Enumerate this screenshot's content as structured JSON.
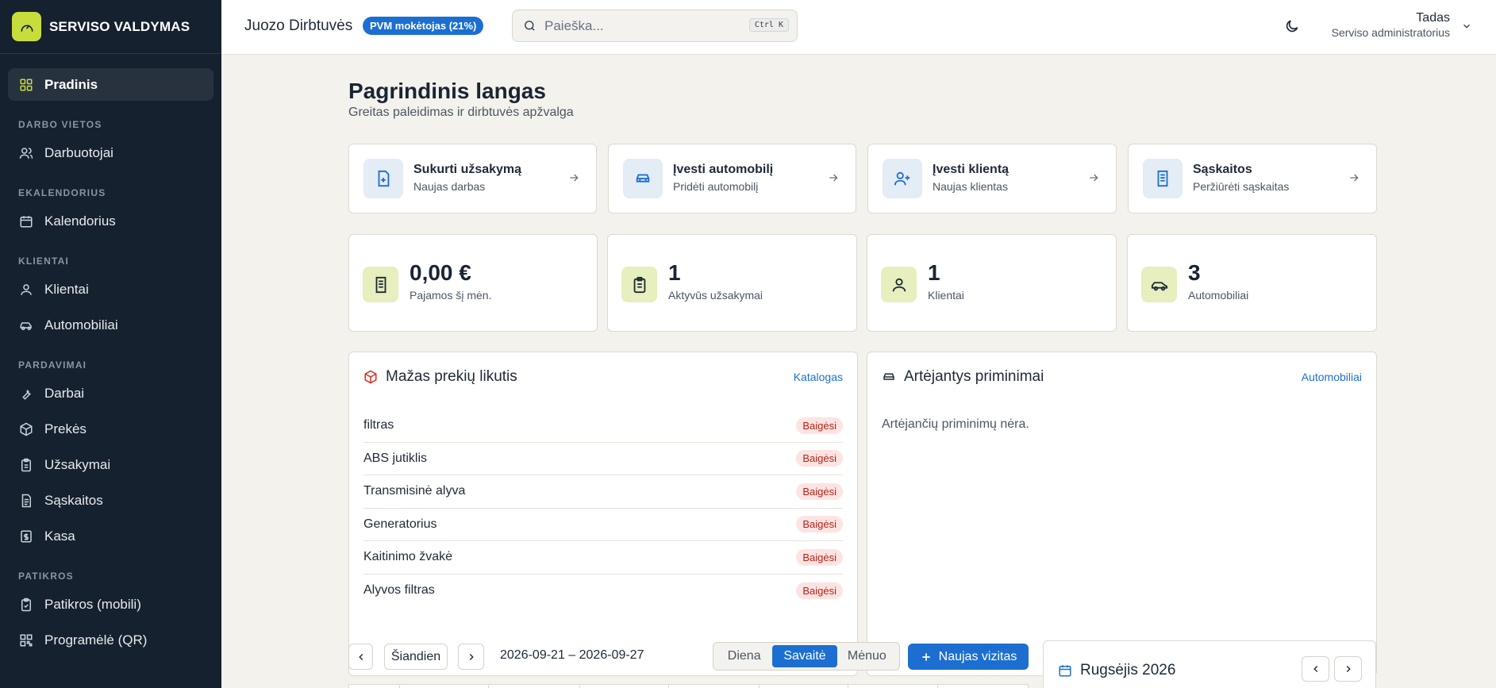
{
  "app": {
    "brand": "SERVISO VALDYMAS",
    "brand_icon": "gauge-icon",
    "accent": "#c6dd3c",
    "primary": "#1c6fd1"
  },
  "sidebar": {
    "home": "Pradinis",
    "groups": [
      {
        "label": "DARBO VIETOS",
        "items": [
          {
            "label": "Darbuotojai",
            "icon": "users-icon"
          }
        ]
      },
      {
        "label": "EKALENDORIUS",
        "items": [
          {
            "label": "Kalendorius",
            "icon": "calendar-icon"
          }
        ]
      },
      {
        "label": "KLIENTAI",
        "items": [
          {
            "label": "Klientai",
            "icon": "user-icon"
          },
          {
            "label": "Automobiliai",
            "icon": "car-icon"
          }
        ]
      },
      {
        "label": "PARDAVIMAI",
        "items": [
          {
            "label": "Darbai",
            "icon": "wrench-icon"
          },
          {
            "label": "Prekės",
            "icon": "package-icon"
          },
          {
            "label": "Užsakymai",
            "icon": "clipboard-icon"
          },
          {
            "label": "Sąskaitos",
            "icon": "receipt-icon"
          },
          {
            "label": "Kasa",
            "icon": "cash-icon"
          }
        ]
      },
      {
        "label": "PATIKROS",
        "items": [
          {
            "label": "Patikros (mobili)",
            "icon": "clipboard-check-icon"
          },
          {
            "label": "Programėlė (QR)",
            "icon": "qr-icon"
          }
        ]
      }
    ]
  },
  "topbar": {
    "workshop": "Juozo Dirbtuvės",
    "vat_badge": "PVM mokėtojas (21%)",
    "search_placeholder": "Paieška...",
    "shortcut": "Ctrl K",
    "user_name": "Tadas",
    "user_role": "Serviso administratorius"
  },
  "page": {
    "title": "Pagrindinis langas",
    "subtitle": "Greitas paleidimas ir dirbtuvės apžvalga"
  },
  "quick_actions": [
    {
      "title": "Sukurti užsakymą",
      "sub": "Naujas darbas",
      "icon": "file-plus-icon"
    },
    {
      "title": "Įvesti automobilį",
      "sub": "Pridėti automobilį",
      "icon": "car-icon"
    },
    {
      "title": "Įvesti klientą",
      "sub": "Naujas klientas",
      "icon": "user-plus-icon"
    },
    {
      "title": "Sąskaitos",
      "sub": "Peržiūrėti sąskaitas",
      "icon": "receipt-icon"
    }
  ],
  "stats": [
    {
      "value": "0,00 €",
      "label": "Pajamos šį mėn.",
      "icon": "receipt-icon"
    },
    {
      "value": "1",
      "label": "Aktyvūs užsakymai",
      "icon": "clipboard-icon"
    },
    {
      "value": "1",
      "label": "Klientai",
      "icon": "user-icon"
    },
    {
      "value": "3",
      "label": "Automobiliai",
      "icon": "car-icon"
    }
  ],
  "low_stock": {
    "title": "Mažas prekių likutis",
    "link": "Katalogas",
    "items": [
      {
        "name": "filtras",
        "status": "Baigėsi"
      },
      {
        "name": "ABS jutiklis",
        "status": "Baigėsi"
      },
      {
        "name": "Transmisinė alyva",
        "status": "Baigėsi"
      },
      {
        "name": "Generatorius",
        "status": "Baigėsi"
      },
      {
        "name": "Kaitinimo žvakė",
        "status": "Baigėsi"
      },
      {
        "name": "Alyvos filtras",
        "status": "Baigėsi"
      }
    ]
  },
  "reminders": {
    "title": "Artėjantys priminimai",
    "link": "Automobiliai",
    "empty": "Artėjančių priminimų nėra."
  },
  "calendar": {
    "today": "Šiandien",
    "range": "2026-09-21 – 2026-09-27",
    "views": [
      "Diena",
      "Savaitė",
      "Mėnuo"
    ],
    "active_view": "Savaitė",
    "new_visit": "Naujas vizitas",
    "month": "Rugsėjis 2026"
  }
}
